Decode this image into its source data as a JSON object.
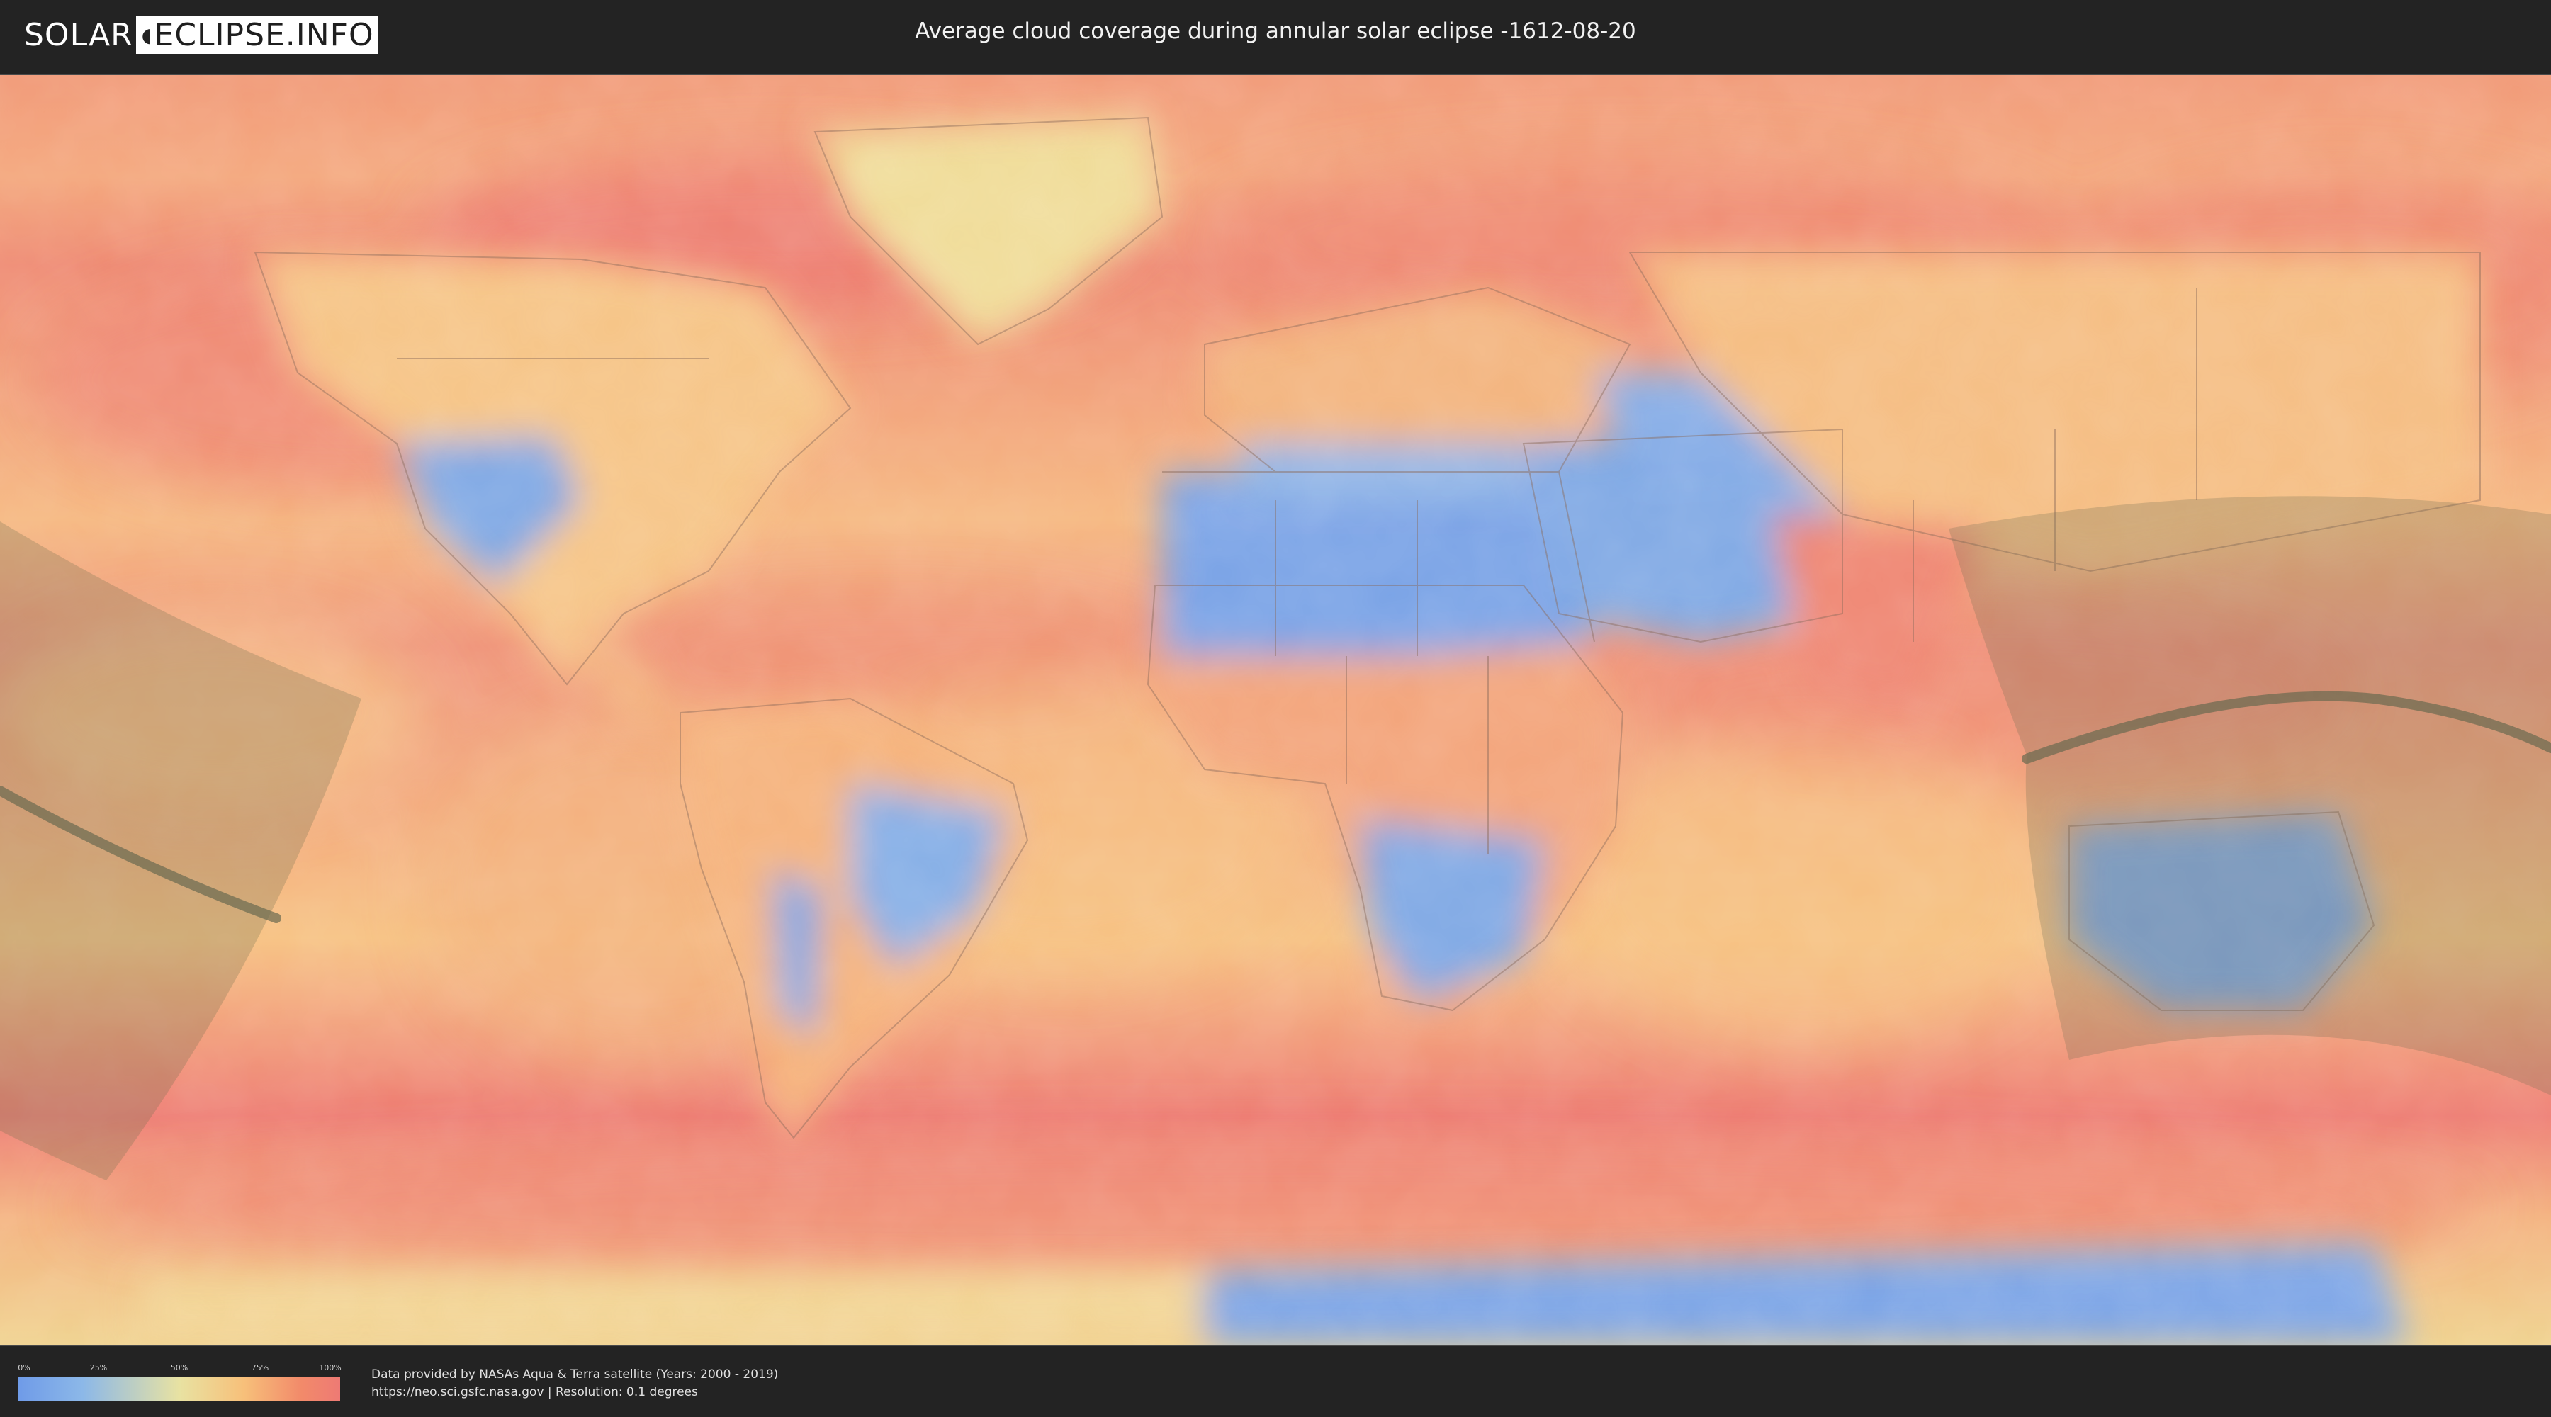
{
  "header": {
    "logo_part1": "SOLAR",
    "logo_part2": "ECLIPSE.INFO",
    "title": "Average cloud coverage during annular solar eclipse -1612-08-20"
  },
  "map": {
    "projection": "equirectangular world map",
    "layer": "average cloud coverage",
    "features": [
      "cloud-coverage-heatmap",
      "country-borders",
      "eclipse-visibility-zone",
      "annularity-center-line"
    ]
  },
  "legend": {
    "ticks": [
      "0%",
      "25%",
      "50%",
      "75%",
      "100%"
    ],
    "colors": {
      "low": "#6f9be8",
      "mid": "#e8e2a2",
      "high": "#ee7a74"
    }
  },
  "footer": {
    "source_line1": "Data provided by NASAs Aqua & Terra satellite (Years: 2000 - 2019)",
    "source_line2": "https://neo.sci.gsfc.nasa.gov | Resolution: 0.1 degrees"
  }
}
